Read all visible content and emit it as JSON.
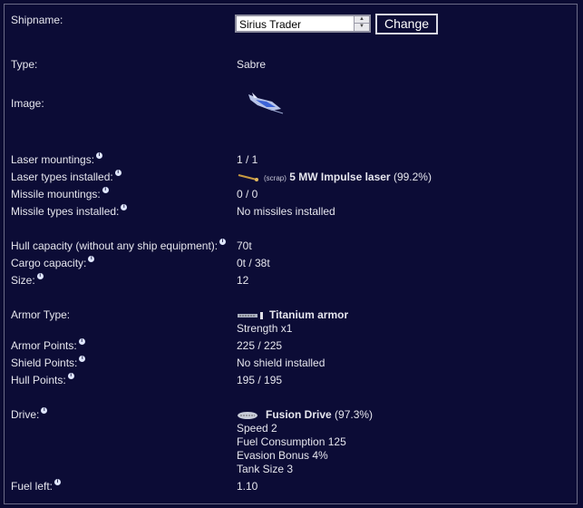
{
  "shipname": {
    "label": "Shipname:",
    "value": "Sirius Trader",
    "button": "Change"
  },
  "type": {
    "label": "Type:",
    "value": "Sabre"
  },
  "image": {
    "label": "Image:"
  },
  "laser_mountings": {
    "label": "Laser mountings:",
    "value": "1 / 1"
  },
  "laser_types": {
    "label": "Laser types installed:",
    "prefix": "(scrap)",
    "name": "5 MW Impulse laser",
    "condition": "(99.2%)"
  },
  "missile_mountings": {
    "label": "Missile mountings:",
    "value": "0 / 0"
  },
  "missile_types": {
    "label": "Missile types installed:",
    "value": "No missiles installed"
  },
  "hull_capacity": {
    "label": "Hull capacity (without any ship equipment):",
    "value": "70t"
  },
  "cargo_capacity": {
    "label": "Cargo capacity:",
    "value": "0t / 38t"
  },
  "size": {
    "label": "Size:",
    "value": "12"
  },
  "armor_type": {
    "label": "Armor Type:",
    "name": "Titanium armor",
    "detail": "Strength x1"
  },
  "armor_points": {
    "label": "Armor Points:",
    "value": "225 / 225"
  },
  "shield_points": {
    "label": "Shield Points:",
    "value": "No shield installed"
  },
  "hull_points": {
    "label": "Hull Points:",
    "value": "195 / 195"
  },
  "drive": {
    "label": "Drive:",
    "name": "Fusion Drive",
    "condition": "(97.3%)",
    "details": [
      "Speed 2",
      "Fuel Consumption 125",
      "Evasion Bonus 4%",
      "Tank Size 3"
    ]
  },
  "fuel_left": {
    "label": "Fuel left:",
    "value": "1.10"
  },
  "info_glyph": "i"
}
